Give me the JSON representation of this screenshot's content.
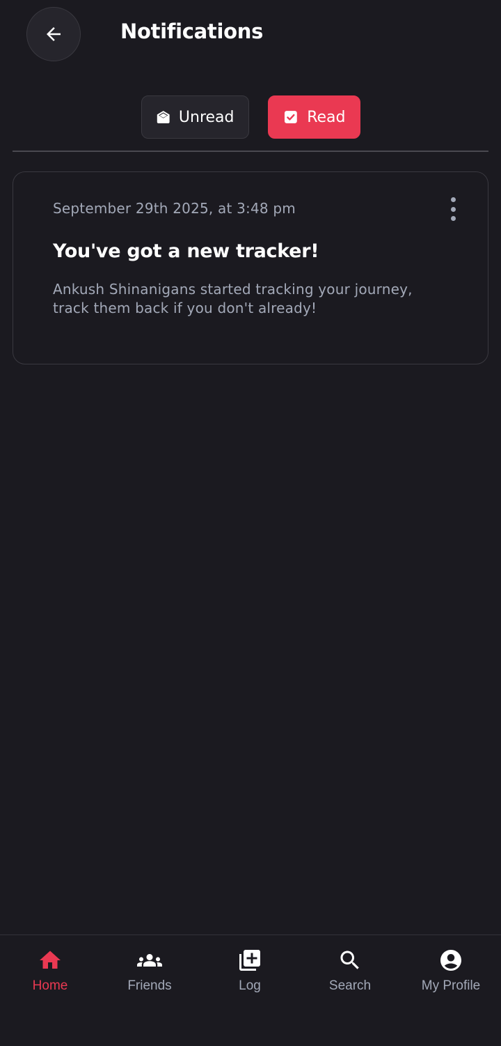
{
  "header": {
    "title": "Notifications"
  },
  "filters": {
    "unread_label": "Unread",
    "read_label": "Read",
    "active": "read"
  },
  "notifications": [
    {
      "date": "September 29th 2025, at 3:48 pm",
      "title": "You've got a new tracker!",
      "body": "Ankush Shinanigans started tracking your journey, track them back if you don't already!"
    }
  ],
  "bottom_nav": {
    "items": [
      {
        "label": "Home",
        "icon": "home-icon",
        "active": true
      },
      {
        "label": "Friends",
        "icon": "group-icon",
        "active": false
      },
      {
        "label": "Log",
        "icon": "add-library-icon",
        "active": false
      },
      {
        "label": "Search",
        "icon": "search-icon",
        "active": false
      },
      {
        "label": "My Profile",
        "icon": "account-circle-icon",
        "active": false
      }
    ]
  },
  "colors": {
    "background": "#1b1a20",
    "accent": "#ea3952",
    "surface": "#26252c",
    "muted_text": "#a3a9b8"
  }
}
